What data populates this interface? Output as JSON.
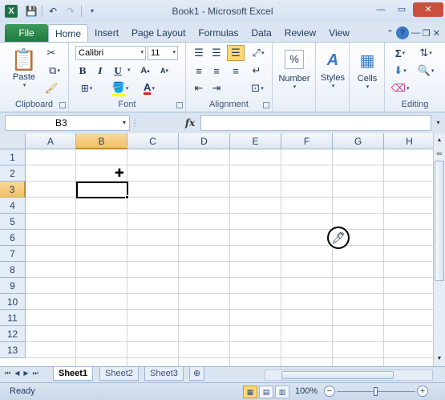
{
  "window": {
    "title": "Book1 - Microsoft Excel",
    "app_icon": "X",
    "controls": {
      "minimize": "—",
      "maximize": "▭",
      "close": "✕"
    }
  },
  "qat": {
    "save_icon": "save-icon",
    "undo_icon": "undo-icon",
    "redo_icon": "redo-icon"
  },
  "tabs": {
    "file": "File",
    "items": [
      "Home",
      "Insert",
      "Page Layout",
      "Formulas",
      "Data",
      "Review",
      "View"
    ],
    "active": "Home"
  },
  "ribbon": {
    "clipboard": {
      "label": "Clipboard",
      "paste": "Paste"
    },
    "font": {
      "label": "Font",
      "name": "Calibri",
      "size": "11",
      "bold": "B",
      "italic": "I",
      "underline": "U"
    },
    "alignment": {
      "label": "Alignment"
    },
    "number": {
      "label": "Number",
      "icon_text": "%"
    },
    "styles": {
      "label": "Styles"
    },
    "cells": {
      "label": "Cells"
    },
    "editing": {
      "label": "Editing"
    }
  },
  "formula_bar": {
    "name_box": "B3",
    "fx": "fx",
    "value": ""
  },
  "grid": {
    "columns": [
      "A",
      "B",
      "C",
      "D",
      "E",
      "F",
      "G",
      "H"
    ],
    "rows": [
      "1",
      "2",
      "3",
      "4",
      "5",
      "6",
      "7",
      "8",
      "9",
      "10",
      "11",
      "12",
      "13"
    ],
    "active_cell": "B3",
    "selected_column": "B",
    "selected_row": "3"
  },
  "sheets": {
    "tabs": [
      "Sheet1",
      "Sheet2",
      "Sheet3"
    ],
    "active": "Sheet1"
  },
  "statusbar": {
    "status": "Ready",
    "zoom": "100%",
    "zoom_minus": "−",
    "zoom_plus": "+"
  }
}
